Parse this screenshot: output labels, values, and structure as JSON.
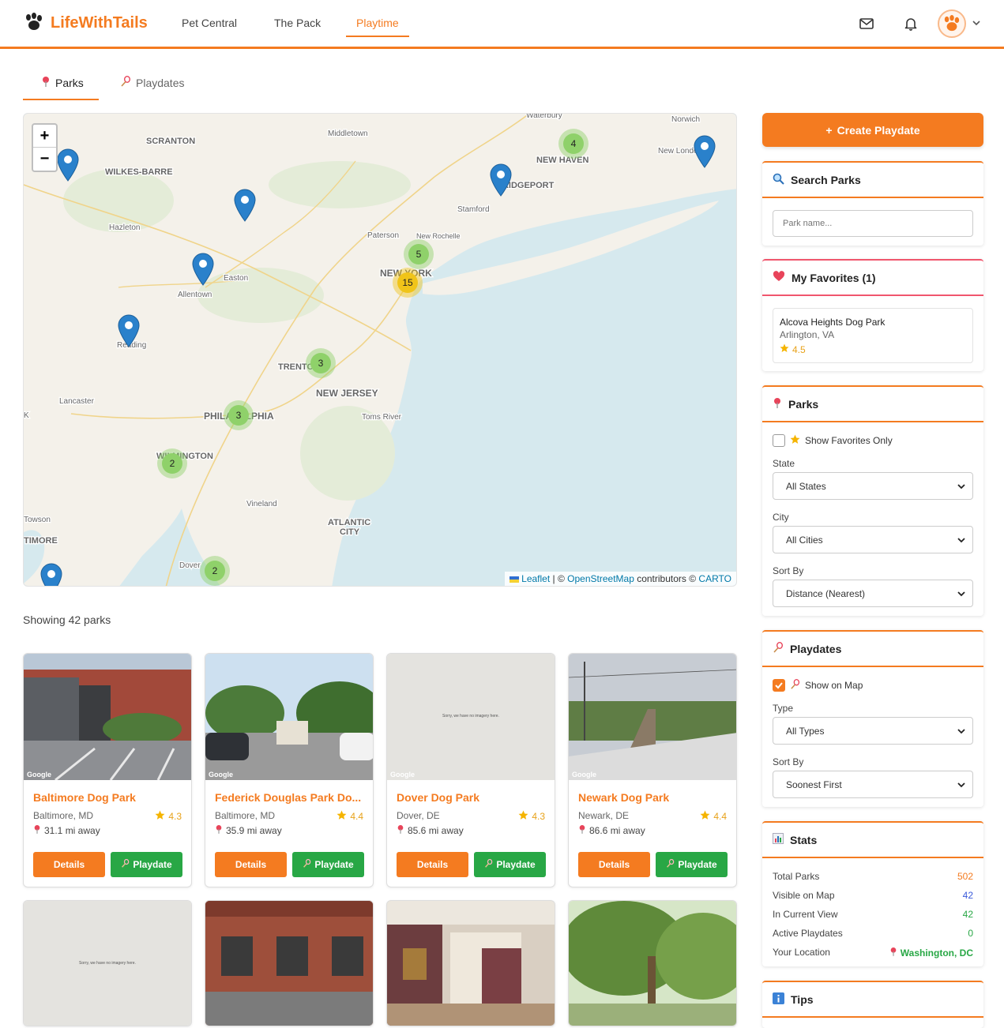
{
  "header": {
    "brand": "LifeWithTails",
    "nav": [
      "Pet Central",
      "The Pack",
      "Playtime"
    ]
  },
  "subtabs": [
    "Parks",
    "Playdates"
  ],
  "map": {
    "labels": [
      {
        "text": "SCRANTON"
      },
      {
        "text": "WILKES-BARRE"
      },
      {
        "text": "Hazleton"
      },
      {
        "text": "Allentown"
      },
      {
        "text": "Easton"
      },
      {
        "text": "Reading"
      },
      {
        "text": "Lancaster"
      },
      {
        "text": "PHILADELPHIA"
      },
      {
        "text": "WILMINGTON"
      },
      {
        "text": "TRENTON"
      },
      {
        "text": "NEW JERSEY"
      },
      {
        "text": "Toms River"
      },
      {
        "text": "Vineland"
      },
      {
        "text": "ATLANTIC"
      },
      {
        "text": "CITY"
      },
      {
        "text": "Dover"
      },
      {
        "text": "Towson"
      },
      {
        "text": "TIMORE"
      },
      {
        "text": "Middletown"
      },
      {
        "text": "Waterbury"
      },
      {
        "text": "Norwich"
      },
      {
        "text": "New London"
      },
      {
        "text": "NEW HAVEN"
      },
      {
        "text": "BRIDGEPORT"
      },
      {
        "text": "Stamford"
      },
      {
        "text": "Paterson"
      },
      {
        "text": "New Rochelle"
      },
      {
        "text": "NEW YORK"
      },
      {
        "text": "K"
      }
    ],
    "clusters": [
      {
        "count": "4",
        "color": "#8fd16a"
      },
      {
        "count": "5",
        "color": "#8fd16a"
      },
      {
        "count": "15",
        "color": "#f0c419"
      },
      {
        "count": "3",
        "color": "#8fd16a"
      },
      {
        "count": "3",
        "color": "#8fd16a"
      },
      {
        "count": "2",
        "color": "#8fd16a"
      },
      {
        "count": "2",
        "color": "#8fd16a"
      }
    ],
    "zoom_in": "+",
    "zoom_out": "−",
    "attribution": {
      "leaflet": "Leaflet",
      "sep": " | © ",
      "osm": "OpenStreetMap",
      "contrib": " contributors © ",
      "carto": "CARTO"
    }
  },
  "showing": "Showing 42 parks",
  "parks": [
    {
      "name": "Baltimore Dog Park",
      "location": "Baltimore, MD",
      "rating": "4.3",
      "distance": "31.1 mi away",
      "photo": "brick",
      "google": "Google"
    },
    {
      "name": "Federick Douglas Park Do...",
      "location": "Baltimore, MD",
      "rating": "4.4",
      "distance": "35.9 mi away",
      "photo": "lot",
      "google": "Google"
    },
    {
      "name": "Dover Dog Park",
      "location": "Dover, DE",
      "rating": "4.3",
      "distance": "85.6 mi away",
      "photo": "none",
      "google": "Google",
      "noimg": "Sorry, we have no imagery here."
    },
    {
      "name": "Newark Dog Park",
      "location": "Newark, DE",
      "rating": "4.4",
      "distance": "86.6 mi away",
      "photo": "rail",
      "google": "Google"
    },
    {
      "name": "",
      "location": "",
      "rating": "",
      "distance": "",
      "photo": "none",
      "google": "",
      "noimg": "Sorry, we have no imagery here."
    },
    {
      "name": "",
      "location": "",
      "rating": "",
      "distance": "",
      "photo": "building",
      "google": ""
    },
    {
      "name": "",
      "location": "",
      "rating": "",
      "distance": "",
      "photo": "gallery",
      "google": ""
    },
    {
      "name": "",
      "location": "",
      "rating": "",
      "distance": "",
      "photo": "tree",
      "google": ""
    }
  ],
  "card_buttons": {
    "details": "Details",
    "playdate": "Playdate"
  },
  "sidebar": {
    "create_button": "Create Playdate",
    "search": {
      "title": "Search Parks",
      "placeholder": "Park name..."
    },
    "favorites": {
      "title": "My Favorites (1)",
      "items": [
        {
          "name": "Alcova Heights Dog Park",
          "location": "Arlington, VA",
          "rating": "4.5"
        }
      ]
    },
    "parks_filter": {
      "title": "Parks",
      "show_favorites": "Show Favorites Only",
      "state_label": "State",
      "state_value": "All States",
      "city_label": "City",
      "city_value": "All Cities",
      "sort_label": "Sort By",
      "sort_value": "Distance (Nearest)"
    },
    "playdates_filter": {
      "title": "Playdates",
      "show_on_map": "Show on Map",
      "type_label": "Type",
      "type_value": "All Types",
      "sort_label": "Sort By",
      "sort_value": "Soonest First"
    },
    "stats": {
      "title": "Stats",
      "rows": [
        {
          "label": "Total Parks",
          "value": "502",
          "color": "#f47b20"
        },
        {
          "label": "Visible on Map",
          "value": "42",
          "color": "#3b5bdb"
        },
        {
          "label": "In Current View",
          "value": "42",
          "color": "#28a745"
        },
        {
          "label": "Active Playdates",
          "value": "0",
          "color": "#28a745"
        },
        {
          "label": "Your Location",
          "value": "Washington, DC",
          "color": "#28a745"
        }
      ]
    },
    "tips": {
      "title": "Tips"
    }
  },
  "colors": {
    "accent": "#f47b20",
    "green": "#28a745",
    "favorite": "#f0566d"
  }
}
